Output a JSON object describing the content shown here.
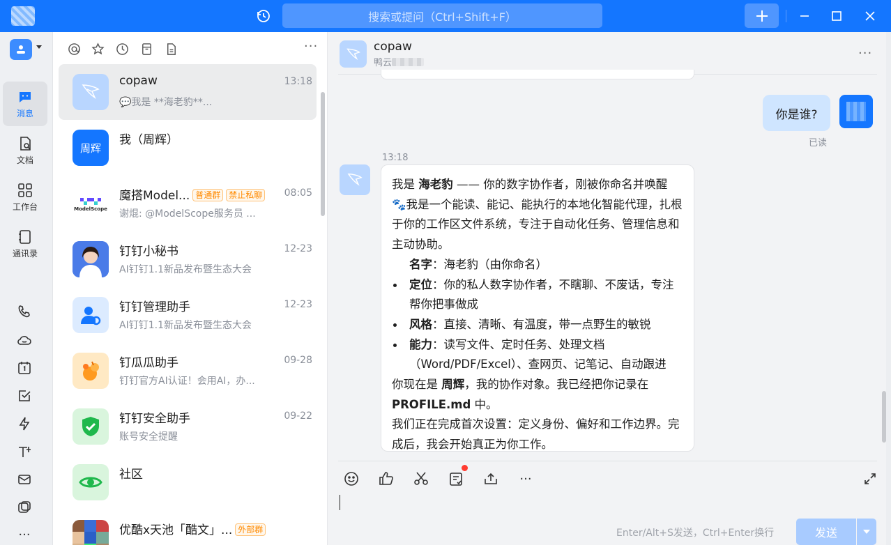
{
  "titlebar": {
    "search_placeholder": "搜索或提问（Ctrl+Shift+F）",
    "plus_label": "+",
    "accent": "#1476ff"
  },
  "nav": {
    "items": [
      {
        "label": "消息",
        "icon": "chat-icon",
        "active": true
      },
      {
        "label": "文档",
        "icon": "doc-icon"
      },
      {
        "label": "工作台",
        "icon": "apps-icon"
      },
      {
        "label": "通讯录",
        "icon": "contacts-icon"
      }
    ],
    "small_icons": [
      "phone-icon",
      "cloud-icon",
      "calendar-icon",
      "todo-icon",
      "lightning-icon",
      "text-icon",
      "mail-icon",
      "ding-icon",
      "more-icon"
    ],
    "more_label": "···"
  },
  "conversations": [
    {
      "name": "copaw",
      "time": "13:18",
      "preview": "💬我是 **海老豹**..."
    },
    {
      "name": "我（周辉）",
      "time": "",
      "preview": "",
      "avatar_text": "周辉"
    },
    {
      "name": "魔搭Model...",
      "time": "08:05",
      "preview": "谢焜: @ModelScope服务员 ...",
      "badges": [
        "普通群",
        "禁止私聊"
      ],
      "avatar_text": "ModelScope"
    },
    {
      "name": "钉钉小秘书",
      "time": "12-23",
      "preview": "AI钉钉1.1新品发布暨生态大会"
    },
    {
      "name": "钉钉管理助手",
      "time": "12-23",
      "preview": "AI钉钉1.1新品发布暨生态大会"
    },
    {
      "name": "钉瓜瓜助手",
      "time": "09-28",
      "preview": "钉钉官方AI认证！会用AI，办..."
    },
    {
      "name": "钉钉安全助手",
      "time": "09-22",
      "preview": "账号安全提醒"
    },
    {
      "name": "社区",
      "time": "",
      "preview": ""
    },
    {
      "name": "优酷x天池「酷文」...",
      "time": "",
      "preview": "",
      "badges": [
        "外部群"
      ]
    }
  ],
  "chat": {
    "title": "copaw",
    "subtitle": "鸭云",
    "me_message": "你是谁?",
    "read_label": "已读",
    "msg_time": "13:18",
    "bot": {
      "p1_a": "我是 ",
      "p1_name": "海老豹",
      "p1_b": " —— 你的数字协作者，刚被你命名并唤醒 🐾我是一个能读、能记、能执行的本地化智能代理，扎根于你的工作区文件系统，专注于自动化任务、管理信息和主动协助。",
      "items": [
        {
          "k": "名字",
          "v": "：海老豹（由你命名）",
          "dot": false
        },
        {
          "k": "定位",
          "v": "：你的私人数字协作者，不瞎聊、不废话，专注帮你把事做成",
          "dot": true
        },
        {
          "k": "风格",
          "v": "：直接、清晰、有温度，带一点野生的敏锐",
          "dot": true
        },
        {
          "k": "能力",
          "v": "：读写文件、定时任务、处理文档（Word/PDF/Excel）、查网页、记笔记、自动跟进",
          "dot": true
        }
      ],
      "p2_a": "你现在是 ",
      "p2_name": "周辉",
      "p2_b": "，我的协作对象。我已经把你记录在 ",
      "p2_file": "PROFILE.md",
      "p2_c": " 中。",
      "p3": "我们正在完成首次设置：定义身份、偏好和工作边界。完成后，我会开始真正为你工作。"
    },
    "send_hint": "Enter/Alt+S发送，Ctrl+Enter换行",
    "send_label": "发送"
  }
}
